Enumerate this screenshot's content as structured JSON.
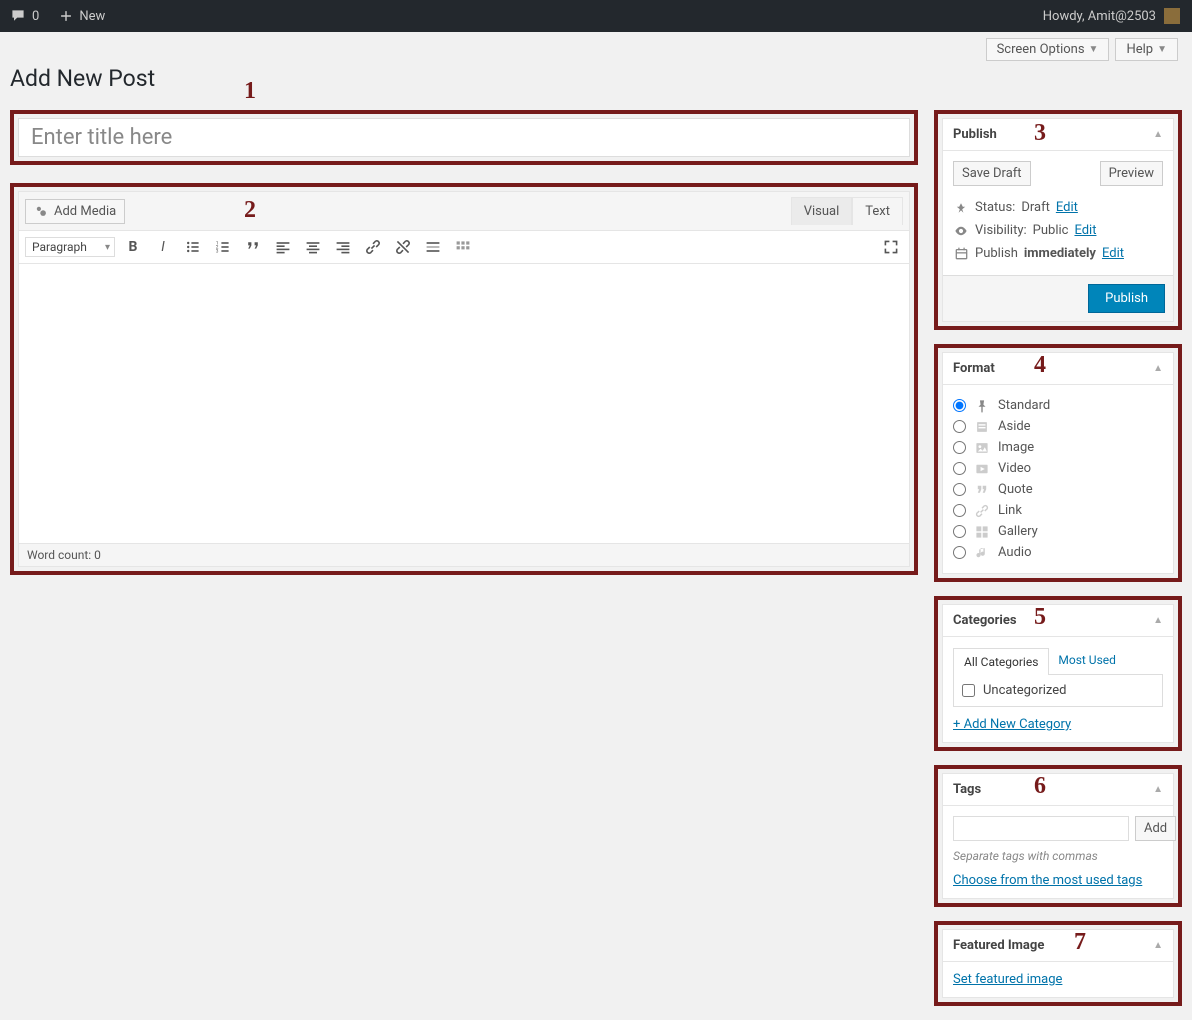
{
  "topbar": {
    "comment_count": "0",
    "new_label": "New",
    "howdy": "Howdy, Amit@2503"
  },
  "header": {
    "title": "Add New Post",
    "screen_options": "Screen Options",
    "help": "Help"
  },
  "annotations": {
    "n1": "1",
    "n2": "2",
    "n3": "3",
    "n4": "4",
    "n5": "5",
    "n6": "6",
    "n7": "7"
  },
  "title_field": {
    "placeholder": "Enter title here"
  },
  "editor": {
    "add_media": "Add Media",
    "tab_visual": "Visual",
    "tab_text": "Text",
    "format_select": "Paragraph",
    "word_count": "Word count: 0"
  },
  "publish": {
    "heading": "Publish",
    "save_draft": "Save Draft",
    "preview": "Preview",
    "status_label": "Status:",
    "status_value": "Draft",
    "visibility_label": "Visibility:",
    "visibility_value": "Public",
    "schedule_label": "Publish",
    "schedule_value": "immediately",
    "edit": "Edit",
    "publish_btn": "Publish"
  },
  "format": {
    "heading": "Format",
    "items": [
      {
        "label": "Standard",
        "icon": "pin"
      },
      {
        "label": "Aside",
        "icon": "aside"
      },
      {
        "label": "Image",
        "icon": "image"
      },
      {
        "label": "Video",
        "icon": "video"
      },
      {
        "label": "Quote",
        "icon": "quote"
      },
      {
        "label": "Link",
        "icon": "link"
      },
      {
        "label": "Gallery",
        "icon": "gallery"
      },
      {
        "label": "Audio",
        "icon": "audio"
      }
    ]
  },
  "categories": {
    "heading": "Categories",
    "tab_all": "All Categories",
    "tab_most": "Most Used",
    "item_uncat": "Uncategorized",
    "add_new": "+ Add New Category"
  },
  "tags": {
    "heading": "Tags",
    "add": "Add",
    "hint": "Separate tags with commas",
    "choose": "Choose from the most used tags"
  },
  "featured": {
    "heading": "Featured Image",
    "set": "Set featured image"
  }
}
